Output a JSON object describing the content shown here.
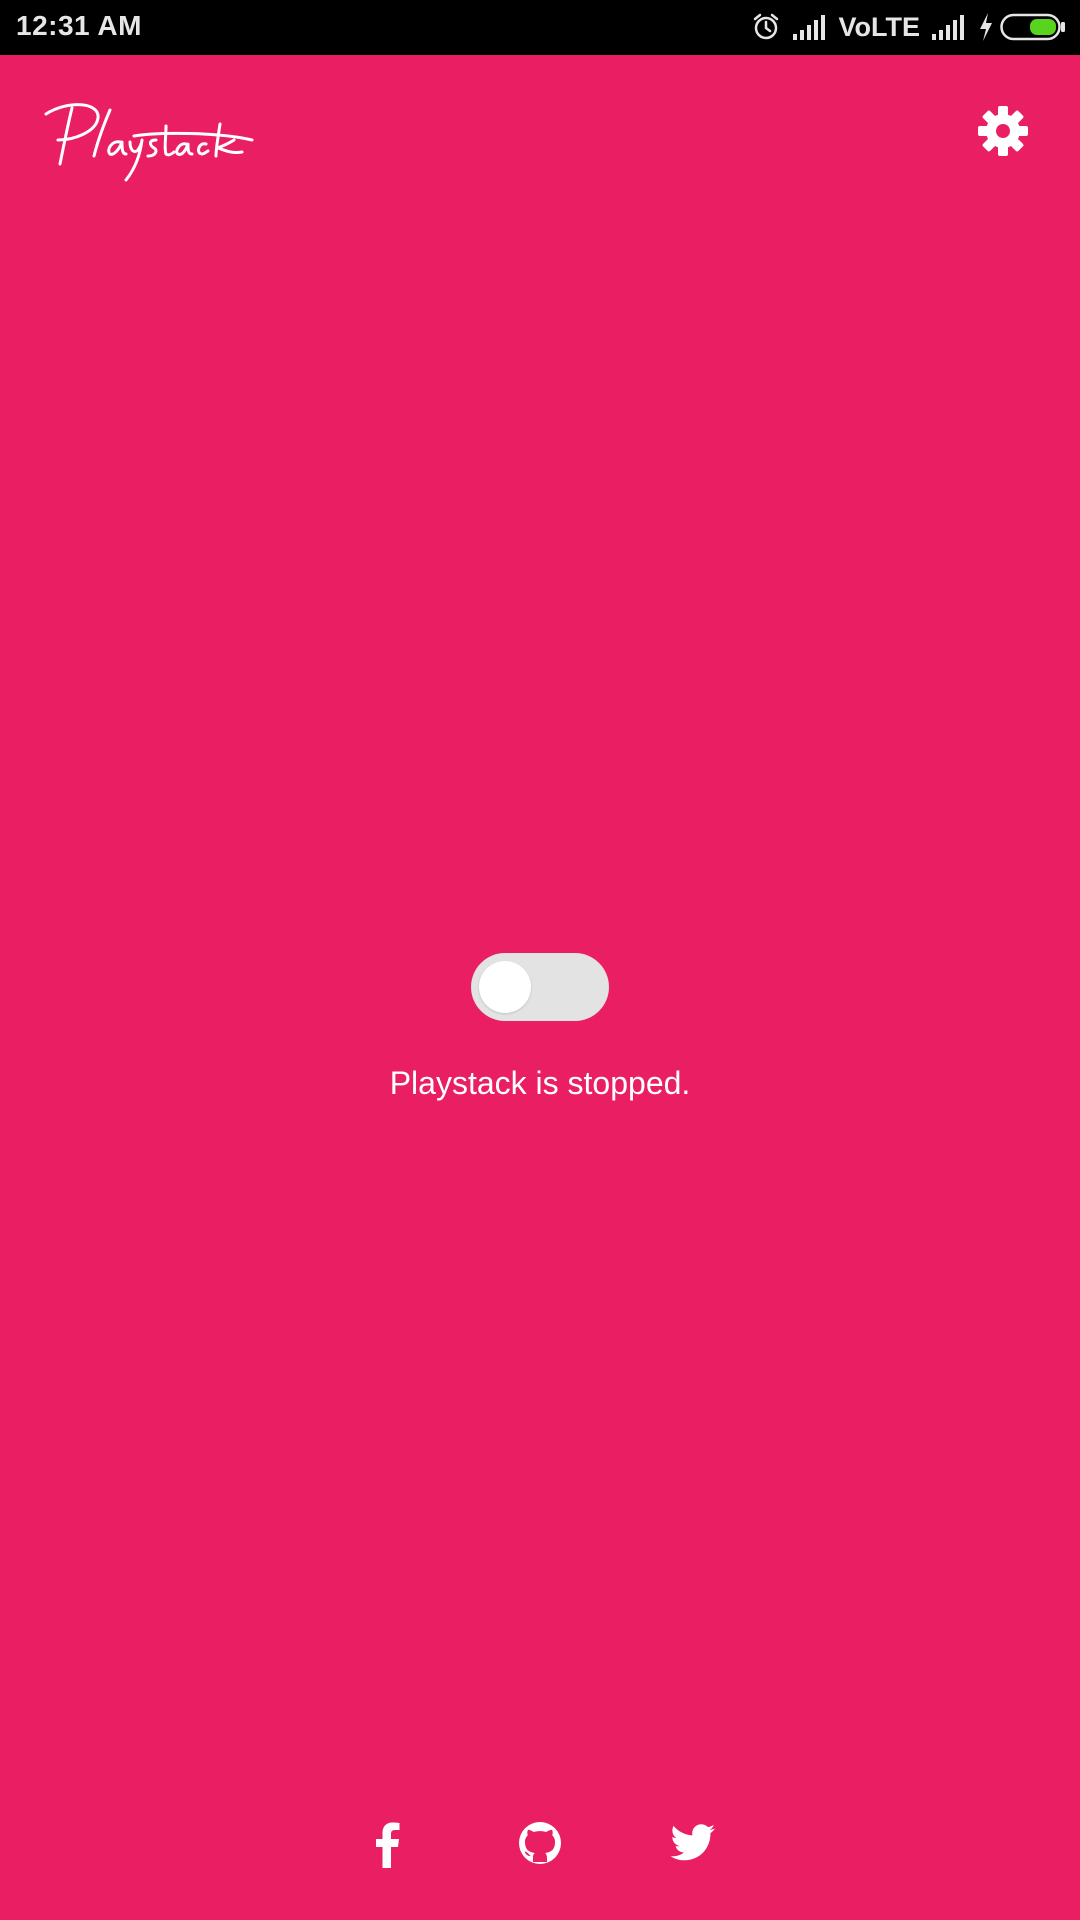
{
  "status_bar": {
    "time": "12:31 AM",
    "network_label": "VoLTE",
    "icons": [
      "alarm-icon",
      "signal-icon",
      "signal-icon",
      "charging-icon",
      "battery-icon"
    ],
    "battery_color": "#58d31e"
  },
  "app": {
    "logo_text": "Playstack",
    "accent_color": "#e91e63",
    "settings_icon": "gear-icon"
  },
  "main": {
    "toggle_on": false,
    "status_text": "Playstack is stopped."
  },
  "social": {
    "icons": [
      "facebook-icon",
      "github-icon",
      "twitter-icon"
    ]
  }
}
